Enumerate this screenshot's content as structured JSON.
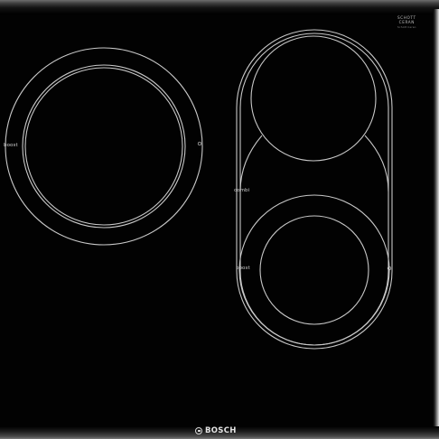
{
  "brand": {
    "logo_text": "BOSCH",
    "glass_maker_line1": "SCHOTT",
    "glass_maker_line2": "CERAN",
    "glass_maker_small": "Schott Ceran"
  },
  "zones": {
    "left_boost_label": "boost",
    "flex_combi_label": "combi",
    "right_boost_label": "boost"
  },
  "colors": {
    "glass": "#020202",
    "zone_outline": "#c8c8c8",
    "trim": "#8c8c8c"
  }
}
